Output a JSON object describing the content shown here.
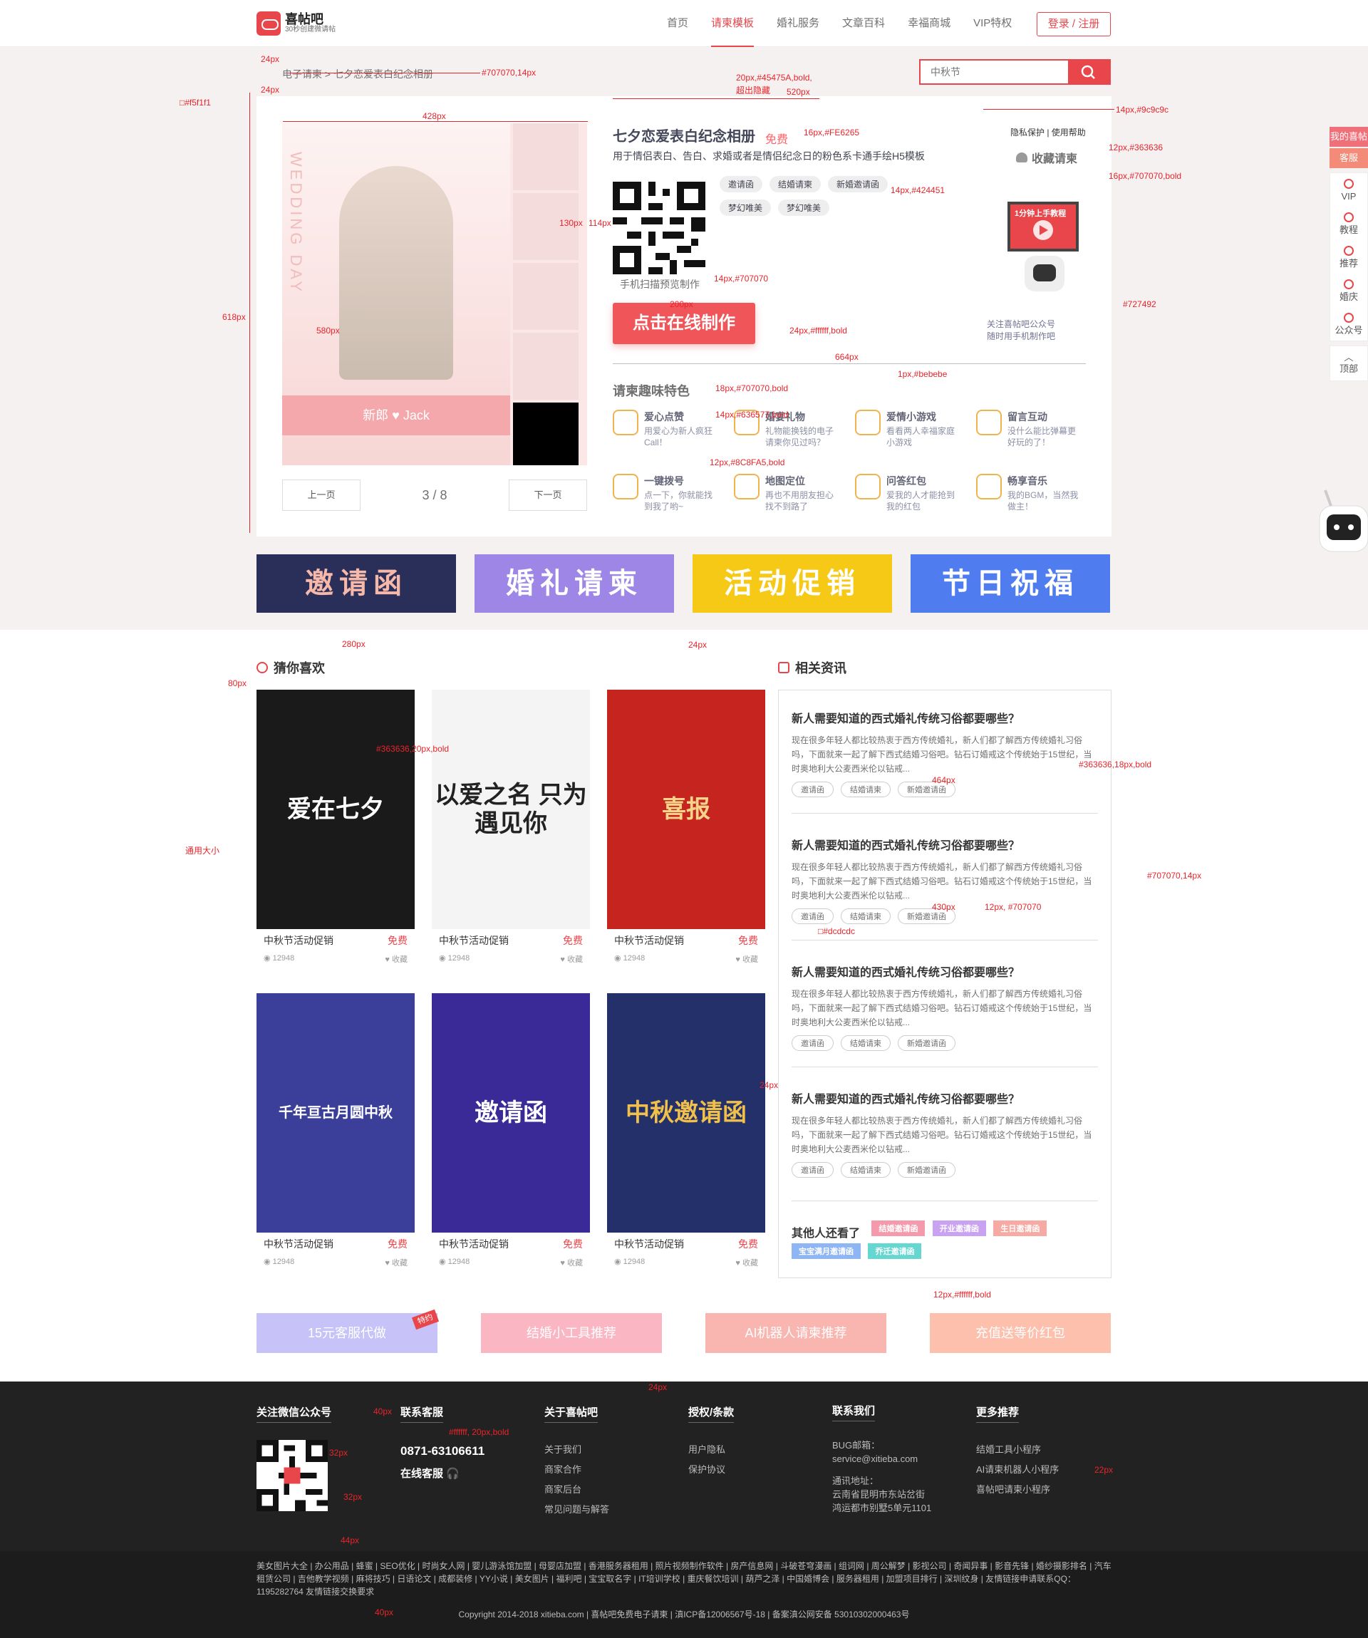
{
  "header": {
    "logo_name": "喜帖吧",
    "logo_sub": "30秒创建微请帖",
    "nav": [
      "首页",
      "请柬模板",
      "婚礼服务",
      "文章百科",
      "幸福商城",
      "VIP特权"
    ],
    "login": "登录 / 注册"
  },
  "breadcrumb": "电子请柬 > 七夕恋爱表白纪念相册",
  "search": {
    "placeholder": "中秋节"
  },
  "template": {
    "title": "七夕恋爱表白纪念相册",
    "free": "免费",
    "desc": "用于情侣表白、告白、求婚或者是情侣纪念日的粉色系卡通手绘H5模板",
    "links": "隐私保护 | 使用帮助",
    "favorite": "收藏请柬",
    "tags": [
      "邀请函",
      "结婚请柬",
      "新婚邀请函",
      "梦幻唯美",
      "梦幻唯美"
    ],
    "qr_hint": "手机扫描预览制作",
    "make_button": "点击在线制作",
    "video_label": "1分钟上手教程",
    "follow_line1": "关注喜帖吧公众号",
    "follow_line2": "随时用手机制作吧",
    "wedding_text": "WEDDING DAY",
    "names": "新郎 ♥ Jack",
    "prev": "上一页",
    "page": "3 / 8",
    "next": "下一页"
  },
  "features": {
    "title": "请柬趣味特色",
    "items": [
      {
        "name": "爱心点赞",
        "desc": "用爱心为新人疯狂Call！",
        "icon": "thumb-icon"
      },
      {
        "name": "婚宴礼物",
        "desc": "礼物能换钱的电子请柬你见过吗？",
        "icon": "gift-icon"
      },
      {
        "name": "爱情小游戏",
        "desc": "看看两人幸福家庭小游戏",
        "icon": "heart-house-icon"
      },
      {
        "name": "留言互动",
        "desc": "没什么能比弹幕更好玩的了！",
        "icon": "chat-icon"
      },
      {
        "name": "一键拨号",
        "desc": "点一下，你就能找到我了哟~",
        "icon": "phone-icon"
      },
      {
        "name": "地图定位",
        "desc": "再也不用朋友担心找不到路了",
        "icon": "map-icon"
      },
      {
        "name": "问答红包",
        "desc": "爱我的人才能抢到我的红包",
        "icon": "redpacket-icon"
      },
      {
        "name": "畅享音乐",
        "desc": "我的BGM，当然我做主！",
        "icon": "music-icon"
      }
    ]
  },
  "banners": [
    {
      "label": "邀请函",
      "color": "#2a2f5a"
    },
    {
      "label": "婚礼请柬",
      "color": "#9d86e6"
    },
    {
      "label": "活动促销",
      "color": "#f6c916"
    },
    {
      "label": "节日祝福",
      "color": "#4f7df0"
    }
  ],
  "guess": {
    "title": "猜你喜欢",
    "cards": [
      {
        "img": "爱在七夕",
        "bg": "#1a1a1a",
        "name": "中秋节活动促销",
        "free": "免费",
        "views": "12948",
        "fav": "收藏"
      },
      {
        "img": "以爱之名 只为遇见你",
        "bg": "#f4f4f4",
        "name": "中秋节活动促销",
        "free": "免费",
        "views": "12948",
        "fav": "收藏"
      },
      {
        "img": "喜报",
        "bg": "#c6241f",
        "name": "中秋节活动促销",
        "free": "免费",
        "views": "12948",
        "fav": "收藏"
      },
      {
        "img": "千年亘古月圆中秋",
        "bg": "#3b3f9a",
        "name": "中秋节活动促销",
        "free": "免费",
        "views": "12948",
        "fav": "收藏"
      },
      {
        "img": "邀请函",
        "bg": "#3a2a98",
        "name": "中秋节活动促销",
        "free": "免费",
        "views": "12948",
        "fav": "收藏"
      },
      {
        "img": "中秋邀请函",
        "bg": "#23306a",
        "name": "中秋节活动促销",
        "free": "免费",
        "views": "12948",
        "fav": "收藏"
      }
    ]
  },
  "news": {
    "title": "相关资讯",
    "items": [
      {
        "title": "新人需要知道的西式婚礼传统习俗都要哪些？",
        "body": "现在很多年轻人都比较热衷于西方传统婚礼，新人们都了解西方传统婚礼习俗吗，下面就来一起了解下西式结婚习俗吧。钻石订婚戒这个传统始于15世纪，当时奥地利大公麦西米伦以钻戒...",
        "tags": [
          "邀请函",
          "结婚请柬",
          "新婚邀请函"
        ]
      },
      {
        "title": "新人需要知道的西式婚礼传统习俗都要哪些？",
        "body": "现在很多年轻人都比较热衷于西方传统婚礼，新人们都了解西方传统婚礼习俗吗，下面就来一起了解下西式结婚习俗吧。钻石订婚戒这个传统始于15世纪，当时奥地利大公麦西米伦以钻戒...",
        "tags": [
          "邀请函",
          "结婚请柬",
          "新婚邀请函"
        ]
      },
      {
        "title": "新人需要知道的西式婚礼传统习俗都要哪些？",
        "body": "现在很多年轻人都比较热衷于西方传统婚礼，新人们都了解西方传统婚礼习俗吗，下面就来一起了解下西式结婚习俗吧。钻石订婚戒这个传统始于15世纪，当时奥地利大公麦西米伦以钻戒...",
        "tags": [
          "邀请函",
          "结婚请柬",
          "新婚邀请函"
        ]
      },
      {
        "title": "新人需要知道的西式婚礼传统习俗都要哪些？",
        "body": "现在很多年轻人都比较热衷于西方传统婚礼，新人们都了解西方传统婚礼习俗吗，下面就来一起了解下西式结婚习俗吧。钻石订婚戒这个传统始于15世纪，当时奥地利大公麦西米伦以钻戒...",
        "tags": [
          "邀请函",
          "结婚请柬",
          "新婚邀请函"
        ]
      }
    ],
    "others_title": "其他人还看了",
    "others": [
      {
        "label": "结婚邀请函",
        "color": "#f59aac"
      },
      {
        "label": "开业邀请函",
        "color": "#c9a3f2"
      },
      {
        "label": "生日邀请函",
        "color": "#f7a9a3"
      },
      {
        "label": "宝宝满月邀请函",
        "color": "#8fb6f4"
      },
      {
        "label": "乔迁邀请函",
        "color": "#66d6d1"
      }
    ]
  },
  "promo": [
    {
      "label": "15元客服代做",
      "color": "#c7c2f7",
      "hot": "特约"
    },
    {
      "label": "结婚小工具推荐",
      "color": "#fbb6c3"
    },
    {
      "label": "AI机器人请柬推荐",
      "color": "#f9b5b0"
    },
    {
      "label": "充值送等价红包",
      "color": "#fcc0ad"
    }
  ],
  "rail": {
    "top1": "我的喜帖",
    "top2": "客服",
    "items": [
      "VIP",
      "教程",
      "推荐",
      "婚庆",
      "公众号"
    ],
    "totop": "顶部"
  },
  "footer": {
    "wechat": "关注微信公众号",
    "service": "联系客服",
    "phone": "0871-63106611",
    "online": "在线客服",
    "about": {
      "title": "关于喜帖吧",
      "links": [
        "关于我们",
        "商家合作",
        "商家后台",
        "常见问题与解答"
      ]
    },
    "terms": {
      "title": "授权/条款",
      "links": [
        "用户隐私",
        "保护协议"
      ]
    },
    "contact": {
      "title": "联系我们",
      "lines": [
        "BUG邮箱：",
        "service@xitieba.com",
        "",
        "通讯地址：",
        "云南省昆明市东站岔街",
        "鸿运都市别墅5单元1101"
      ]
    },
    "more": {
      "title": "更多推荐",
      "links": [
        "结婚工具小程序",
        "AI请柬机器人小程序",
        "喜帖吧请柬小程序"
      ]
    }
  },
  "friend_links": "美女图片大全 | 办公用品 | 蜂蜜 | SEO优化 | 时尚女人网 | 婴儿游泳馆加盟 | 母婴店加盟 | 香港服务器租用 | 照片视频制作软件 | 房产信息网 | 斗破苍穹漫画 | 组词网 | 周公解梦 | 影视公司 | 奇闻异事 | 影音先锋 | 婚纱摄影排名 | 汽车租赁公司 | 吉他教学视频 | 麻将技巧 | 日语论文 | 成都装修 | YY小说 | 美女图片 | 福利吧 | 宝宝取名字 | IT培训学校 | 重庆餐饮培训 | 葫芦之泽 | 中国婚博会 | 服务器租用 | 加盟项目排行 | 深圳纹身 | 友情链接申请联系QQ：1195282764 友情链接交换要求",
  "copyright": "Copyright 2014-2018 xitieba.com  |  喜帖吧免费电子请柬  |  滇ICP备12006567号-18  |  备案滇公网安备 53010302000463号",
  "annotations": {
    "bg": "□#f5f1f1",
    "bc": "#707070,14px",
    "title": "20px,#45475A,bold,",
    "title2": "超出隐藏",
    "w520": "520px",
    "free": "16px,#FE6265",
    "search": "14px,#9c9c9c",
    "links": "12px,#363636",
    "fav": "16px,#707070,bold",
    "tags": "14px,#424451",
    "qr": "14px,#707070",
    "follow": "#727492",
    "make": "24px,#ffffff,bold",
    "divider": "1px,#bebebe",
    "feat": "18px,#707070,bold",
    "featname": "14px,#636577,bold",
    "featdesc": "12px,#8C8FA5,bold",
    "card": "#363636,20px,bold",
    "general": "通用大小",
    "news": "#363636,18px,bold",
    "newsbody": "#707070,14px",
    "newsbody2": "12px, #707070",
    "tagcolor": "□#dcdcdc",
    "otag": "12px,#ffffff,bold",
    "footerphone": "#ffffff, 20px,bold",
    "d24": "24px",
    "d10": "10px",
    "d58": "58px",
    "d18": "18px",
    "d34": "34px",
    "d265": "265px",
    "d36": "36px",
    "d428": "428px",
    "d30": "30px",
    "d12": "12px",
    "d618": "618px",
    "d580": "580px",
    "d130": "130px",
    "d114": "114px",
    "d8": "8px",
    "d20": "20px",
    "d200": "200px",
    "d664": "664px",
    "d6": "6px",
    "d280": "280px",
    "d80": "80px",
    "d40": "40px",
    "d464": "464px",
    "d14": "14px",
    "d25": "25px",
    "d430": "430px",
    "d32": "32px",
    "d22": "22px",
    "d44": "44px"
  }
}
